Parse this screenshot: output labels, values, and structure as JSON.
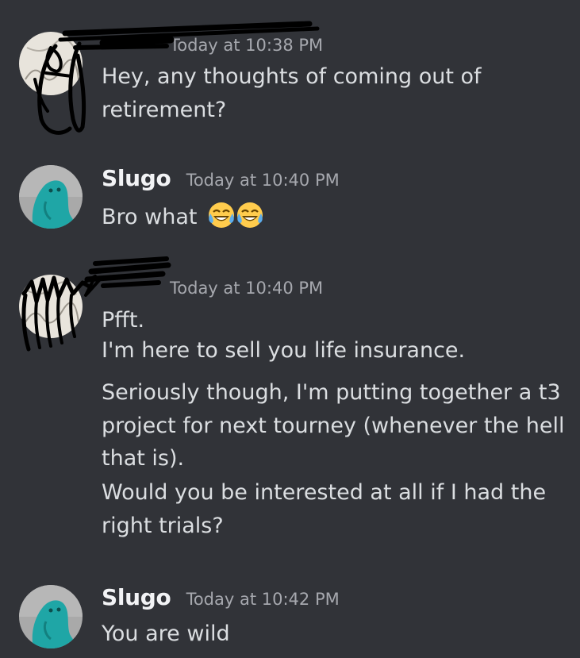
{
  "colors": {
    "background": "#313338",
    "username": "#f2f3f5",
    "timestamp": "#a6a8ae",
    "message_text": "#dbdee1",
    "redaction_scribble": "#000000"
  },
  "messages": [
    {
      "author": "",
      "author_redacted": true,
      "timestamp": "Today at 10:38 PM",
      "avatar_icon": "redacted-avatar-icon",
      "lines": [
        "Hey, any thoughts of coming out of",
        "retirement?"
      ]
    },
    {
      "author": "Slugo",
      "author_redacted": false,
      "timestamp": "Today at 10:40 PM",
      "avatar_icon": "teal-slug-avatar-icon",
      "lines": [
        "Bro what"
      ],
      "emojis": [
        "joy-emoji-icon",
        "joy-emoji-icon"
      ]
    },
    {
      "author": "",
      "author_redacted": true,
      "timestamp": "Today at 10:40 PM",
      "avatar_icon": "redacted-avatar-icon",
      "lines": [
        "Pfft.",
        "I'm here to sell you life insurance.",
        "Seriously though, I'm putting together a t3",
        "project for next tourney (whenever the hell",
        "that is).",
        "Would you be interested at all if I had the",
        "right trials?"
      ]
    },
    {
      "author": "Slugo",
      "author_redacted": false,
      "timestamp": "Today at 10:42 PM",
      "avatar_icon": "teal-slug-avatar-icon",
      "lines": [
        "You are wild"
      ]
    }
  ]
}
